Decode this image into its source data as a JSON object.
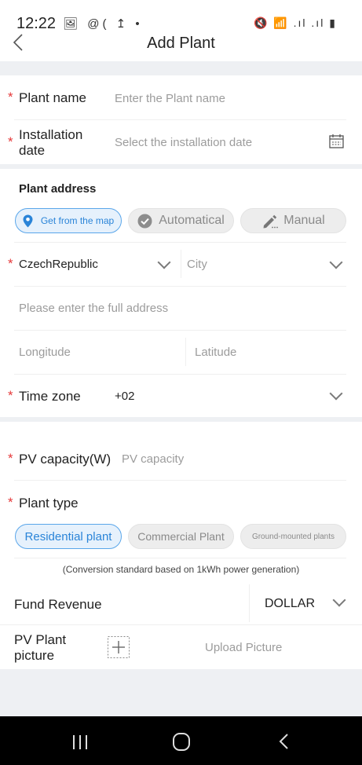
{
  "status_bar": {
    "time": "12:22",
    "left_icons": "🖼 @( ↥ •",
    "right_icons": "🔇 📶 .ıl .ıl ▮"
  },
  "header": {
    "title": "Add Plant",
    "back_icon": "chevron-left"
  },
  "plant_name": {
    "label": "Plant name",
    "placeholder": "Enter the Plant name"
  },
  "installation_date": {
    "label_line1": "Installation",
    "label_line2": "date",
    "placeholder": "Select the installation date"
  },
  "address": {
    "heading": "Plant address",
    "modes": [
      {
        "label": "Get from the map",
        "active": true
      },
      {
        "label": "Automatical",
        "active": false
      },
      {
        "label": "Manual",
        "active": false
      }
    ],
    "country": "CzechRepublic",
    "city_placeholder": "City",
    "full_address_placeholder": "Please enter the full address",
    "longitude_placeholder": "Longitude",
    "latitude_placeholder": "Latitude"
  },
  "time_zone": {
    "label": "Time zone",
    "value": "+02"
  },
  "pv_capacity": {
    "label": "PV capacity(W)",
    "placeholder": "PV capacity"
  },
  "plant_type": {
    "label": "Plant type",
    "options": [
      {
        "label": "Residential plant",
        "active": true
      },
      {
        "label": "Commercial Plant",
        "active": false
      },
      {
        "label": "Ground-mounted plants",
        "active": false
      }
    ],
    "note": "(Conversion standard based on 1kWh power generation)"
  },
  "fund_revenue": {
    "label": "Fund Revenue",
    "currency": "DOLLAR"
  },
  "picture": {
    "label_line1": "PV Plant",
    "label_line2": "picture",
    "upload_label": "Upload Picture"
  },
  "required_marker": "*",
  "colors": {
    "accent": "#2a84d8",
    "required": "#e5393a",
    "separator": "#eef0f3"
  }
}
